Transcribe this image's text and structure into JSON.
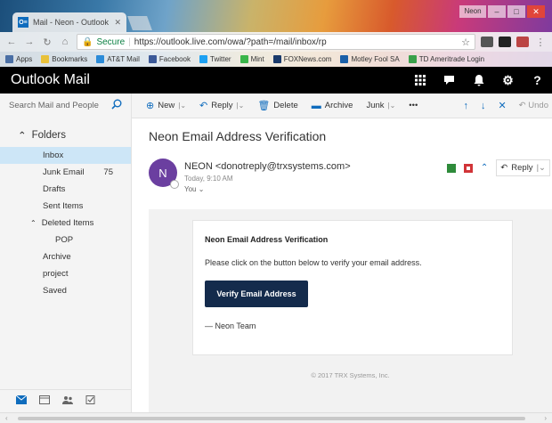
{
  "browser": {
    "tab_title": "Mail - Neon - Outlook",
    "tab_icon": "O≡",
    "window_user": "Neon",
    "secure_label": "Secure",
    "url": "https://outlook.live.com/owa/?path=/mail/inbox/rp",
    "bookmarks": [
      {
        "label": "Apps",
        "color": "#4a6fa5"
      },
      {
        "label": "Bookmarks",
        "color": "#e8c13a"
      },
      {
        "label": "AT&T Mail",
        "color": "#2b8bd8"
      },
      {
        "label": "Facebook",
        "color": "#3b5998"
      },
      {
        "label": "Twitter",
        "color": "#1da1f2"
      },
      {
        "label": "Mint",
        "color": "#3ab54a"
      },
      {
        "label": "FOXNews.com",
        "color": "#1a3a6b"
      },
      {
        "label": "Motley Fool SA",
        "color": "#1a5fa8"
      },
      {
        "label": "TD Ameritrade Login",
        "color": "#3aa04a"
      }
    ]
  },
  "app": {
    "title": "Outlook Mail"
  },
  "search": {
    "placeholder": "Search Mail and People"
  },
  "commands": {
    "new_label": "New",
    "reply_label": "Reply",
    "delete_label": "Delete",
    "archive_label": "Archive",
    "junk_label": "Junk",
    "more_label": "•••",
    "undo_label": "Undo"
  },
  "sidebar": {
    "folders_label": "Folders",
    "items": [
      {
        "label": "Inbox",
        "count": ""
      },
      {
        "label": "Junk Email",
        "count": "75"
      },
      {
        "label": "Drafts",
        "count": ""
      },
      {
        "label": "Sent Items",
        "count": ""
      },
      {
        "label": "Deleted Items",
        "count": ""
      },
      {
        "label": "POP",
        "count": ""
      },
      {
        "label": "Archive",
        "count": ""
      },
      {
        "label": "project",
        "count": ""
      },
      {
        "label": "Saved",
        "count": ""
      }
    ]
  },
  "message": {
    "subject": "Neon Email Address Verification",
    "avatar_letter": "N",
    "sender": "NEON <donotreply@trxsystems.com>",
    "date": "Today, 9:10 AM",
    "to": "You",
    "reply_label": "Reply",
    "card_title": "Neon Email Address Verification",
    "card_text": "Please click on the button below to verify your email address.",
    "button_label": "Verify Email Address",
    "signoff": "— Neon Team",
    "footer": "© 2017 TRX Systems, Inc."
  }
}
